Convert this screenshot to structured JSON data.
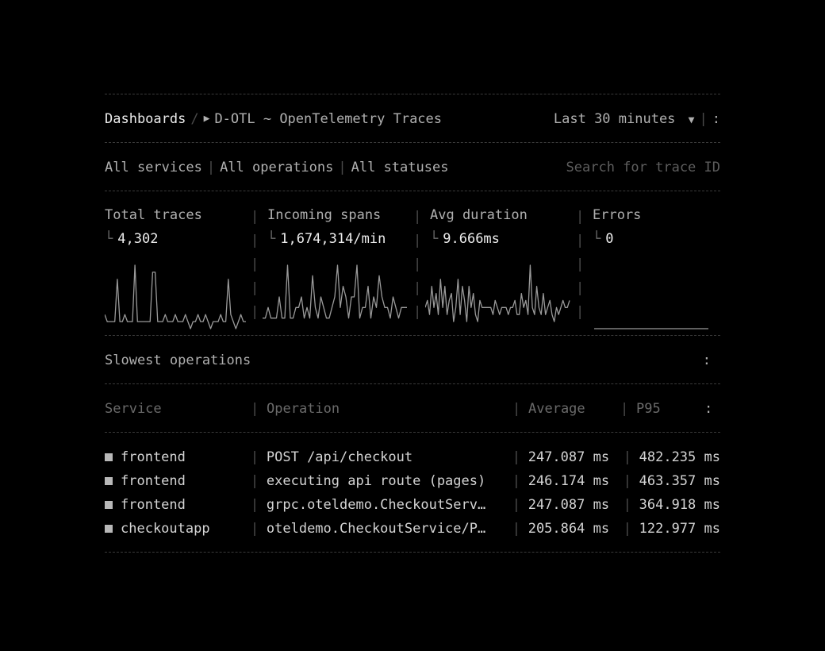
{
  "breadcrumb": {
    "root": "Dashboards",
    "separator": "/",
    "caret": "▶",
    "title": "D-OTL ~ OpenTelemetry Traces"
  },
  "time_range": {
    "label": "Last 30 minutes",
    "arrow": "▼",
    "menu": ":"
  },
  "filters": {
    "services": "All services",
    "operations": "All operations",
    "statuses": "All statuses",
    "search_placeholder": "Search for trace ID"
  },
  "stats": [
    {
      "title": "Total traces",
      "value": "4,302"
    },
    {
      "title": "Incoming spans",
      "value": "1,674,314/min"
    },
    {
      "title": "Avg duration",
      "value": "9.666ms"
    },
    {
      "title": "Errors",
      "value": "0"
    }
  ],
  "sparklines": {
    "total_traces": [
      2,
      1,
      1,
      1,
      1,
      7,
      1,
      1,
      2,
      1,
      1,
      1,
      9,
      1,
      1,
      1,
      1,
      1,
      1,
      8,
      8,
      1,
      1,
      1,
      2,
      1,
      1,
      1,
      2,
      1,
      1,
      1,
      2,
      1,
      0,
      1,
      1,
      2,
      1,
      1,
      2,
      1,
      0,
      1,
      1,
      1,
      2,
      1,
      1,
      7,
      2,
      1,
      0,
      1,
      2,
      1,
      1
    ],
    "incoming_spans": [
      1,
      1,
      2,
      1,
      1,
      1,
      3,
      1,
      1,
      6,
      1,
      1,
      2,
      2,
      3,
      1,
      2,
      1,
      5,
      2,
      1,
      3,
      2,
      1,
      1,
      2,
      3,
      6,
      2,
      4,
      3,
      1,
      3,
      3,
      6,
      1,
      2,
      2,
      4,
      1,
      3,
      2,
      5,
      3,
      2,
      2,
      1,
      3,
      2,
      1,
      2,
      2,
      2
    ],
    "avg_duration": [
      3,
      4,
      2,
      6,
      3,
      5,
      2,
      7,
      3,
      6,
      2,
      4,
      5,
      1,
      3,
      7,
      2,
      6,
      4,
      1,
      6,
      3,
      5,
      2,
      1,
      4,
      3,
      3,
      3,
      3,
      3,
      2,
      4,
      3,
      2,
      3,
      3,
      3,
      2,
      3,
      3,
      4,
      2,
      2,
      5,
      3,
      4,
      2,
      9,
      3,
      2,
      6,
      3,
      2,
      5,
      2,
      3,
      4,
      2,
      1,
      3,
      2,
      3,
      4,
      3,
      3,
      4
    ],
    "errors": [
      0,
      0
    ]
  },
  "slowest": {
    "title": "Slowest operations",
    "menu": ":",
    "columns": [
      "Service",
      "Operation",
      "Average",
      "P95"
    ],
    "rows": [
      {
        "service": "frontend",
        "operation": "POST /api/checkout",
        "average": "247.087 ms",
        "p95": "482.235 ms"
      },
      {
        "service": "frontend",
        "operation": "executing api route (pages)",
        "average": "246.174 ms",
        "p95": "463.357 ms"
      },
      {
        "service": "frontend",
        "operation": "grpc.oteldemo.CheckoutServ…",
        "average": "247.087 ms",
        "p95": "364.918 ms"
      },
      {
        "service": "checkoutapp",
        "operation": "oteldemo.CheckoutService/P…",
        "average": "205.864 ms",
        "p95": "122.977 ms"
      }
    ]
  },
  "colors": {
    "background": "#000000",
    "text_bright": "#ececec",
    "text_dim": "#6a6a6a",
    "spark": "#9a9a9a"
  }
}
